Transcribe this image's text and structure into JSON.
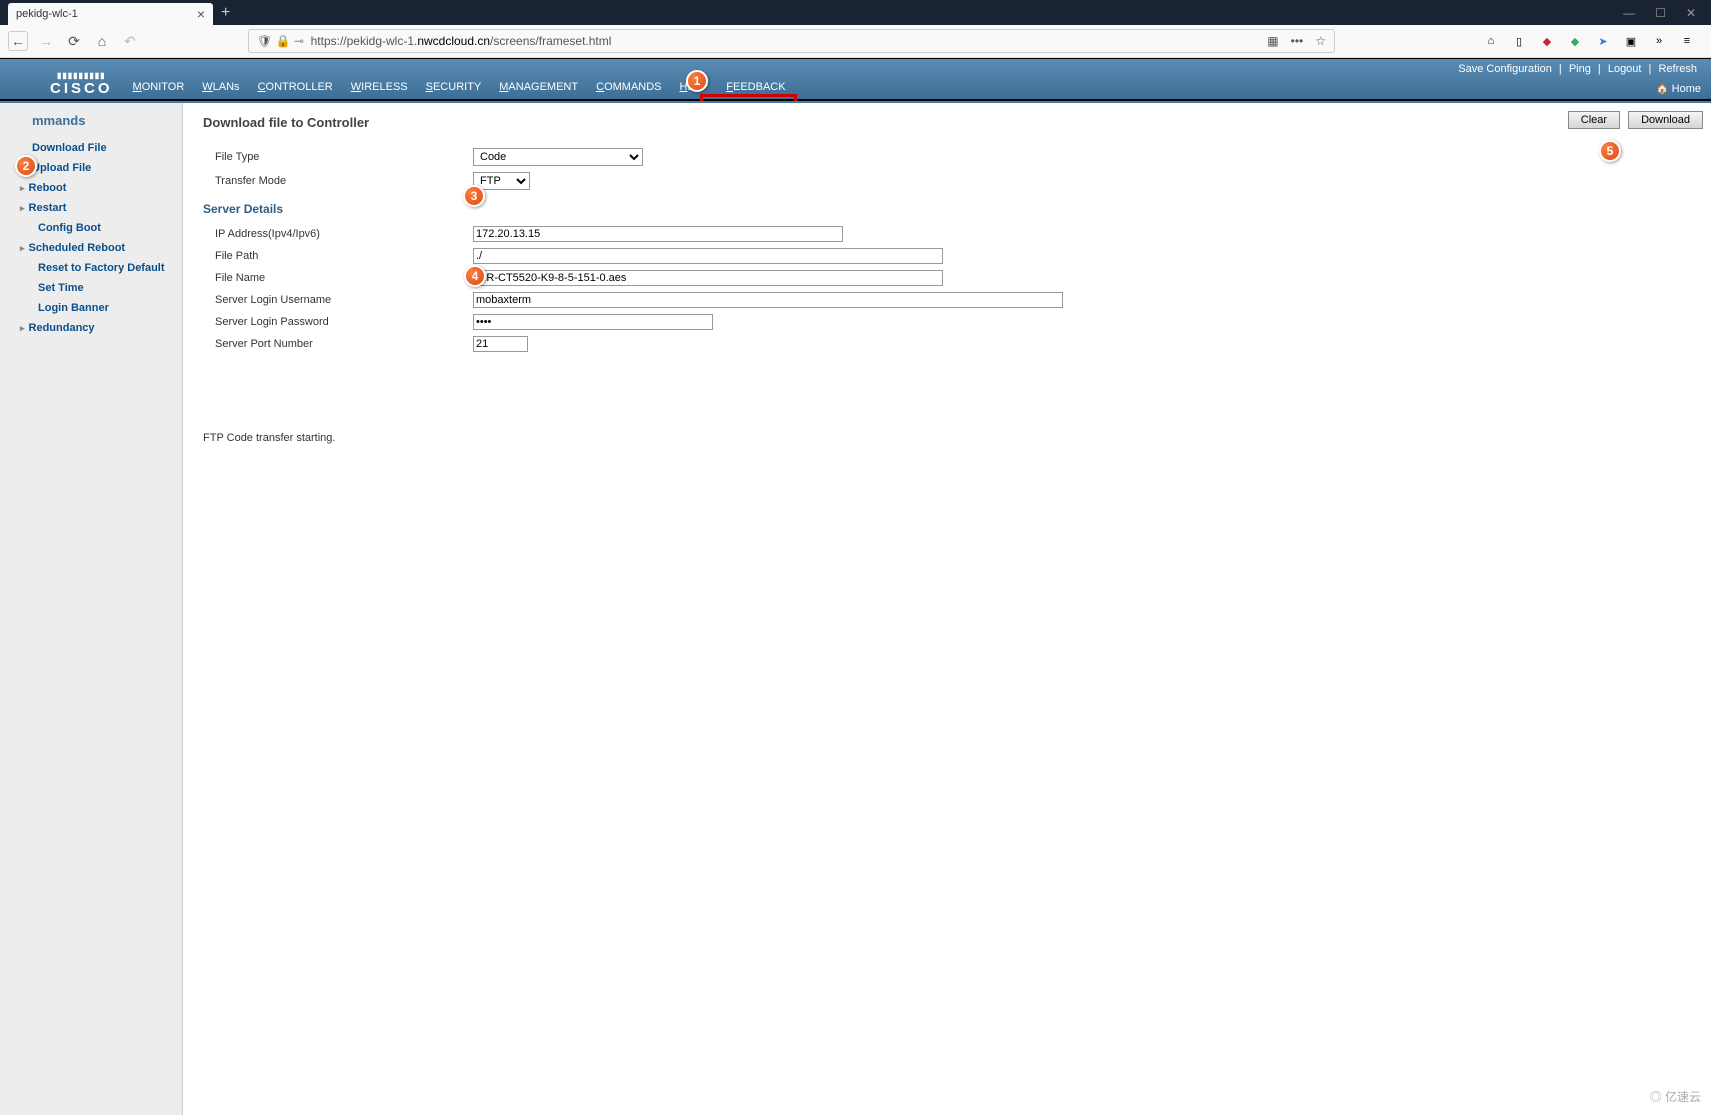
{
  "browser": {
    "tab_title": "pekidg-wlc-1",
    "url_prefix": "https://pekidg-wlc-1.",
    "url_domain": "nwcdcloud.cn",
    "url_path": "/screens/frameset.html"
  },
  "header": {
    "logo_text": "CISCO",
    "nav": [
      "MONITOR",
      "WLANs",
      "CONTROLLER",
      "WIRELESS",
      "SECURITY",
      "MANAGEMENT",
      "COMMANDS",
      "HELP",
      "FEEDBACK"
    ],
    "right_links": [
      "Save Configuration",
      "Ping",
      "Logout",
      "Refresh"
    ],
    "home_label": "Home"
  },
  "sidebar": {
    "title": "mmands",
    "items": [
      {
        "label": "Download File",
        "arrow": false
      },
      {
        "label": "Upload File",
        "arrow": false
      },
      {
        "label": "Reboot",
        "arrow": true
      },
      {
        "label": "Restart",
        "arrow": true
      },
      {
        "label": "Config Boot",
        "arrow": false,
        "indent": true
      },
      {
        "label": "Scheduled Reboot",
        "arrow": true
      },
      {
        "label": "Reset to Factory Default",
        "arrow": false,
        "indent": true
      },
      {
        "label": "Set Time",
        "arrow": false,
        "indent": true
      },
      {
        "label": "Login Banner",
        "arrow": false,
        "indent": true
      },
      {
        "label": "Redundancy",
        "arrow": true
      }
    ]
  },
  "page": {
    "title": "Download file to Controller",
    "clear_btn": "Clear",
    "download_btn": "Download",
    "file_type_label": "File Type",
    "file_type_value": "Code",
    "transfer_mode_label": "Transfer Mode",
    "transfer_mode_value": "FTP",
    "server_details_hdr": "Server Details",
    "ip_label": "IP Address(Ipv4/Ipv6)",
    "ip_value": "172.20.13.15",
    "path_label": "File Path",
    "path_value": "./",
    "name_label": "File Name",
    "name_value": "AIR-CT5520-K9-8-5-151-0.aes",
    "user_label": "Server Login Username",
    "user_value": "mobaxterm",
    "pass_label": "Server Login Password",
    "pass_value": "****",
    "port_label": "Server Port Number",
    "port_value": "21",
    "status": "FTP Code transfer starting."
  },
  "markers": {
    "1": "1",
    "2": "2",
    "3": "3",
    "4": "4",
    "5": "5"
  },
  "watermark": "亿速云"
}
